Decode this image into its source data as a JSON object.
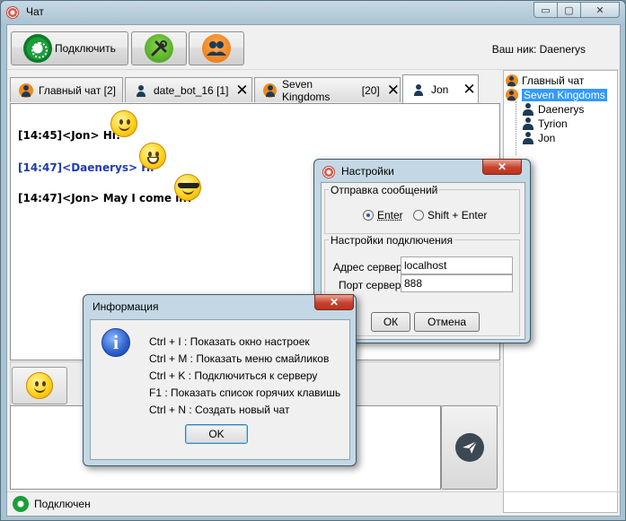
{
  "window": {
    "title": "Чат",
    "min": "▭",
    "max": "▢",
    "close": "✕"
  },
  "toolbar": {
    "connect_label": "Подключить",
    "nick_label": "Ваш ник: Daenerys"
  },
  "tabs": [
    {
      "label": "Главный чат",
      "count": "[2]",
      "icon": "group-icon"
    },
    {
      "label": "date_bot_16",
      "count": "[1]",
      "icon": "user-icon",
      "close": "✕"
    },
    {
      "label": "Seven Kingdoms",
      "count": "[20]",
      "icon": "group-icon",
      "close": "✕"
    },
    {
      "label": "Jon",
      "count": "",
      "icon": "user-icon",
      "close": "✕"
    }
  ],
  "messages": [
    {
      "text": "[14:45]<Jon> Hi!",
      "color": "#000000"
    },
    {
      "text": "[14:47]<Daenerys> Hi",
      "color": "#1f3bb0"
    },
    {
      "text": "[14:47]<Jon> May I come in?",
      "color": "#000000"
    }
  ],
  "tree": {
    "items": [
      {
        "label": "Главный чат"
      },
      {
        "label": "Seven Kingdoms"
      },
      {
        "label": "Daenerys"
      },
      {
        "label": "Tyrion"
      },
      {
        "label": "Jon"
      }
    ]
  },
  "status": {
    "text": "Подключен"
  },
  "settings": {
    "title": "Настройки",
    "close": "✕",
    "group_send": "Отправка сообщений",
    "radio_enter": "Enter",
    "radio_shift": "Shift + Enter",
    "group_conn": "Настройки подключения",
    "server_label": "Адрес сервера",
    "server_value": "localhost",
    "port_label": "Порт сервера",
    "port_value": "888",
    "ok": "ОК",
    "cancel": "Отмена"
  },
  "info": {
    "title": "Информация",
    "close": "✕",
    "icon": "i",
    "lines": [
      "Ctrl + I : Показать окно настроек",
      "Ctrl + M : Показать меню смайликов",
      "Ctrl + K : Подключиться к серверу",
      "F1 : Показать список горячих клавишь",
      "Ctrl + N : Создать новый чат"
    ],
    "ok": "OK"
  }
}
